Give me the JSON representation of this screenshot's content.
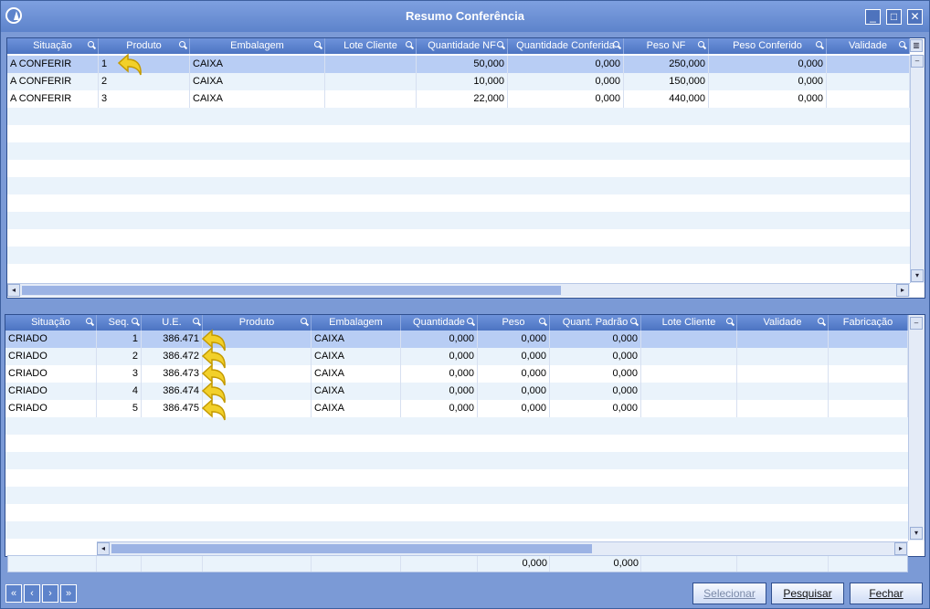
{
  "window": {
    "title": "Resumo Conferência",
    "controls": [
      "_",
      "□",
      "✕"
    ]
  },
  "top_grid": {
    "columns": [
      "Situação",
      "Produto",
      "Embalagem",
      "Lote Cliente",
      "Quantidade NF",
      "Quantidade Conferida",
      "Peso NF",
      "Peso Conferido",
      "Validade"
    ],
    "rows": [
      {
        "situacao": "A CONFERIR",
        "produto": "1",
        "embalagem": "CAIXA",
        "lote": "",
        "qtd_nf": "50,000",
        "qtd_conf": "0,000",
        "peso_nf": "250,000",
        "peso_conf": "0,000",
        "validade": ""
      },
      {
        "situacao": "A CONFERIR",
        "produto": "2",
        "embalagem": "CAIXA",
        "lote": "",
        "qtd_nf": "10,000",
        "qtd_conf": "0,000",
        "peso_nf": "150,000",
        "peso_conf": "0,000",
        "validade": ""
      },
      {
        "situacao": "A CONFERIR",
        "produto": "3",
        "embalagem": "CAIXA",
        "lote": "",
        "qtd_nf": "22,000",
        "qtd_conf": "0,000",
        "peso_nf": "440,000",
        "peso_conf": "0,000",
        "validade": ""
      }
    ]
  },
  "bottom_grid": {
    "columns": [
      "Situação",
      "Seq.",
      "U.E.",
      "Produto",
      "Embalagem",
      "Quantidade",
      "Peso",
      "Quant. Padrão",
      "Lote Cliente",
      "Validade",
      "Fabricação"
    ],
    "rows": [
      {
        "situacao": "CRIADO",
        "seq": "1",
        "ue": "386.471",
        "produto": "",
        "embalagem": "CAIXA",
        "quantidade": "0,000",
        "peso": "0,000",
        "padrao": "0,000"
      },
      {
        "situacao": "CRIADO",
        "seq": "2",
        "ue": "386.472",
        "produto": "",
        "embalagem": "CAIXA",
        "quantidade": "0,000",
        "peso": "0,000",
        "padrao": "0,000"
      },
      {
        "situacao": "CRIADO",
        "seq": "3",
        "ue": "386.473",
        "produto": "",
        "embalagem": "CAIXA",
        "quantidade": "0,000",
        "peso": "0,000",
        "padrao": "0,000"
      },
      {
        "situacao": "CRIADO",
        "seq": "4",
        "ue": "386.474",
        "produto": "",
        "embalagem": "CAIXA",
        "quantidade": "0,000",
        "peso": "0,000",
        "padrao": "0,000"
      },
      {
        "situacao": "CRIADO",
        "seq": "5",
        "ue": "386.475",
        "produto": "",
        "embalagem": "CAIXA",
        "quantidade": "0,000",
        "peso": "0,000",
        "padrao": "0,000"
      }
    ],
    "totals": {
      "peso": "0,000",
      "padrao": "0,000"
    }
  },
  "buttons": {
    "selecionar": "Selecionar",
    "pesquisar": "Pesquisar",
    "fechar": "Fechar"
  },
  "nav": [
    "«",
    "‹",
    "›",
    "»"
  ]
}
